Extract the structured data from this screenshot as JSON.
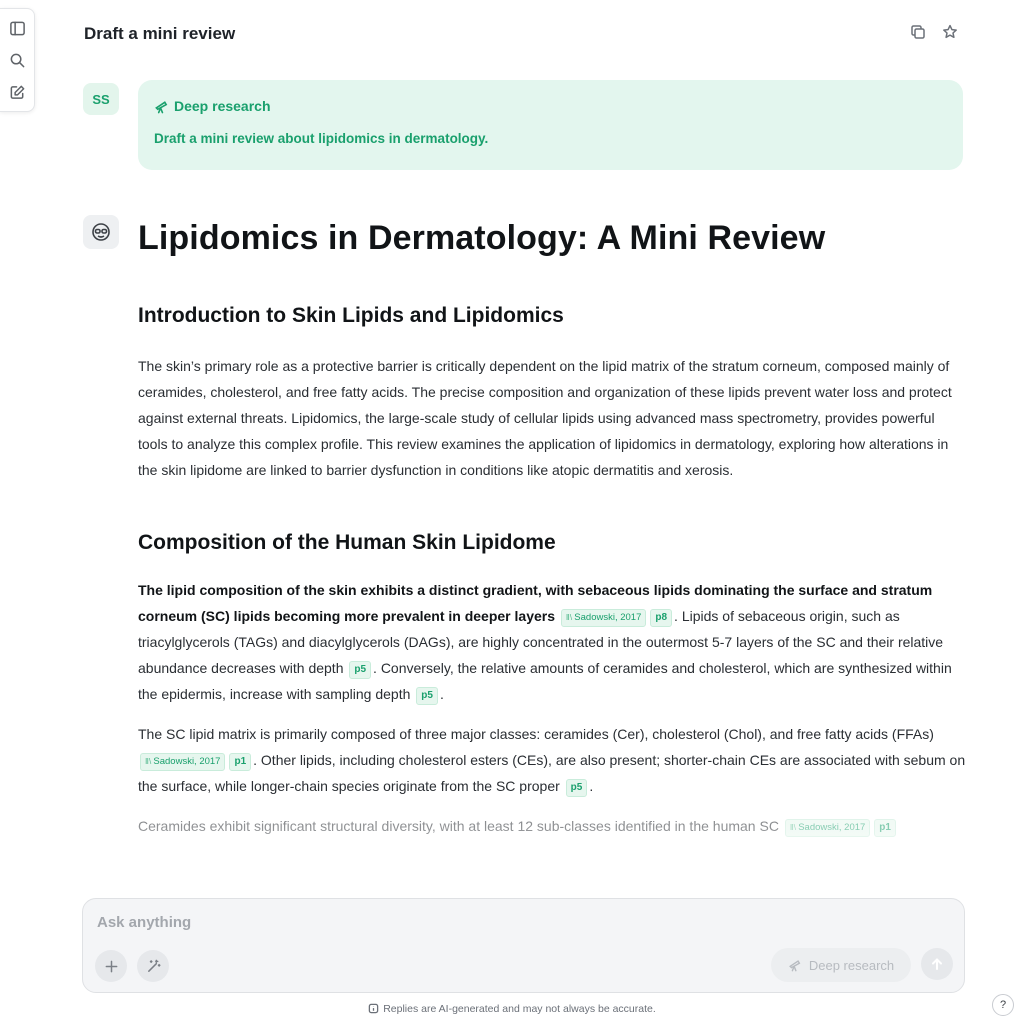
{
  "header": {
    "title": "Draft a mini review"
  },
  "user_message": {
    "avatar": "SS",
    "mode_label": "Deep research",
    "text": "Draft a mini review about lipidomics in dermatology."
  },
  "answer": {
    "title": "Lipidomics in Dermatology: A Mini Review",
    "sections": [
      {
        "heading": "Introduction to Skin Lipids and Lipidomics",
        "paragraph": "The skin’s primary role as a protective barrier is critically dependent on the lipid matrix of the stratum corneum, composed mainly of ceramides, cholesterol, and free fatty acids. The precise composition and organization of these lipids prevent water loss and protect against external threats. Lipidomics, the large-scale study of cellular lipids using advanced mass spectrometry, provides powerful tools to analyze this complex profile. This review examines the application of lipidomics in dermatology, exploring how alterations in the skin lipidome are linked to barrier dysfunction in conditions like atopic dermatitis and xerosis."
      },
      {
        "heading": "Composition of the Human Skin Lipidome",
        "p1": {
          "bold": "The lipid composition of the skin exhibits a distinct gradient, with sebaceous lipids dominating the surface and stratum corneum (SC) lipids becoming more prevalent in deeper layers",
          "cite_src": "Sadowski, 2017",
          "cite_pg1": "p8",
          "text2": ". Lipids of sebaceous origin, such as triacylglycerols (TAGs) and diacylglycerols (DAGs), are highly concentrated in the outermost 5-7 layers of the SC and their relative abundance decreases with depth",
          "cite_pg2": "p5",
          "text3": ". Conversely, the relative amounts of ceramides and cholesterol, which are synthesized within the epidermis, increase with sampling depth",
          "cite_pg3": "p5",
          "text4": "."
        },
        "p2": {
          "text1": "The SC lipid matrix is primarily composed of three major classes: ceramides (Cer), cholesterol (Chol), and free fatty acids (FFAs)",
          "cite_src": "Sadowski, 2017",
          "cite_pg1": "p1",
          "text2": ". Other lipids, including cholesterol esters (CEs), are also present; shorter-chain CEs are associated with sebum on the surface, while longer-chain species originate from the SC proper",
          "cite_pg2": "p5",
          "text3": "."
        },
        "p3": {
          "text1": "Ceramides exhibit significant structural diversity, with at least 12 sub-classes identified in the human SC",
          "cite_src": "Sadowski, 2017",
          "cite_pg1": "p1"
        }
      }
    ]
  },
  "composer": {
    "placeholder": "Ask anything",
    "deep_research_label": "Deep research"
  },
  "footer": {
    "disclaimer": "Replies are AI-generated and may not always be accurate.",
    "help": "?"
  },
  "icons": {
    "sidebar": "sidebar-toggle-icon",
    "search": "search-icon",
    "new_chat": "edit-icon",
    "copy": "copy-icon",
    "star": "star-icon",
    "telescope": "telescope-icon",
    "bot": "bot-avatar-icon",
    "plus": "plus-icon",
    "magic": "magic-wand-icon",
    "send": "send-arrow-icon"
  },
  "colors": {
    "accent": "#1aa06d",
    "bubble": "#e3f6ee"
  }
}
